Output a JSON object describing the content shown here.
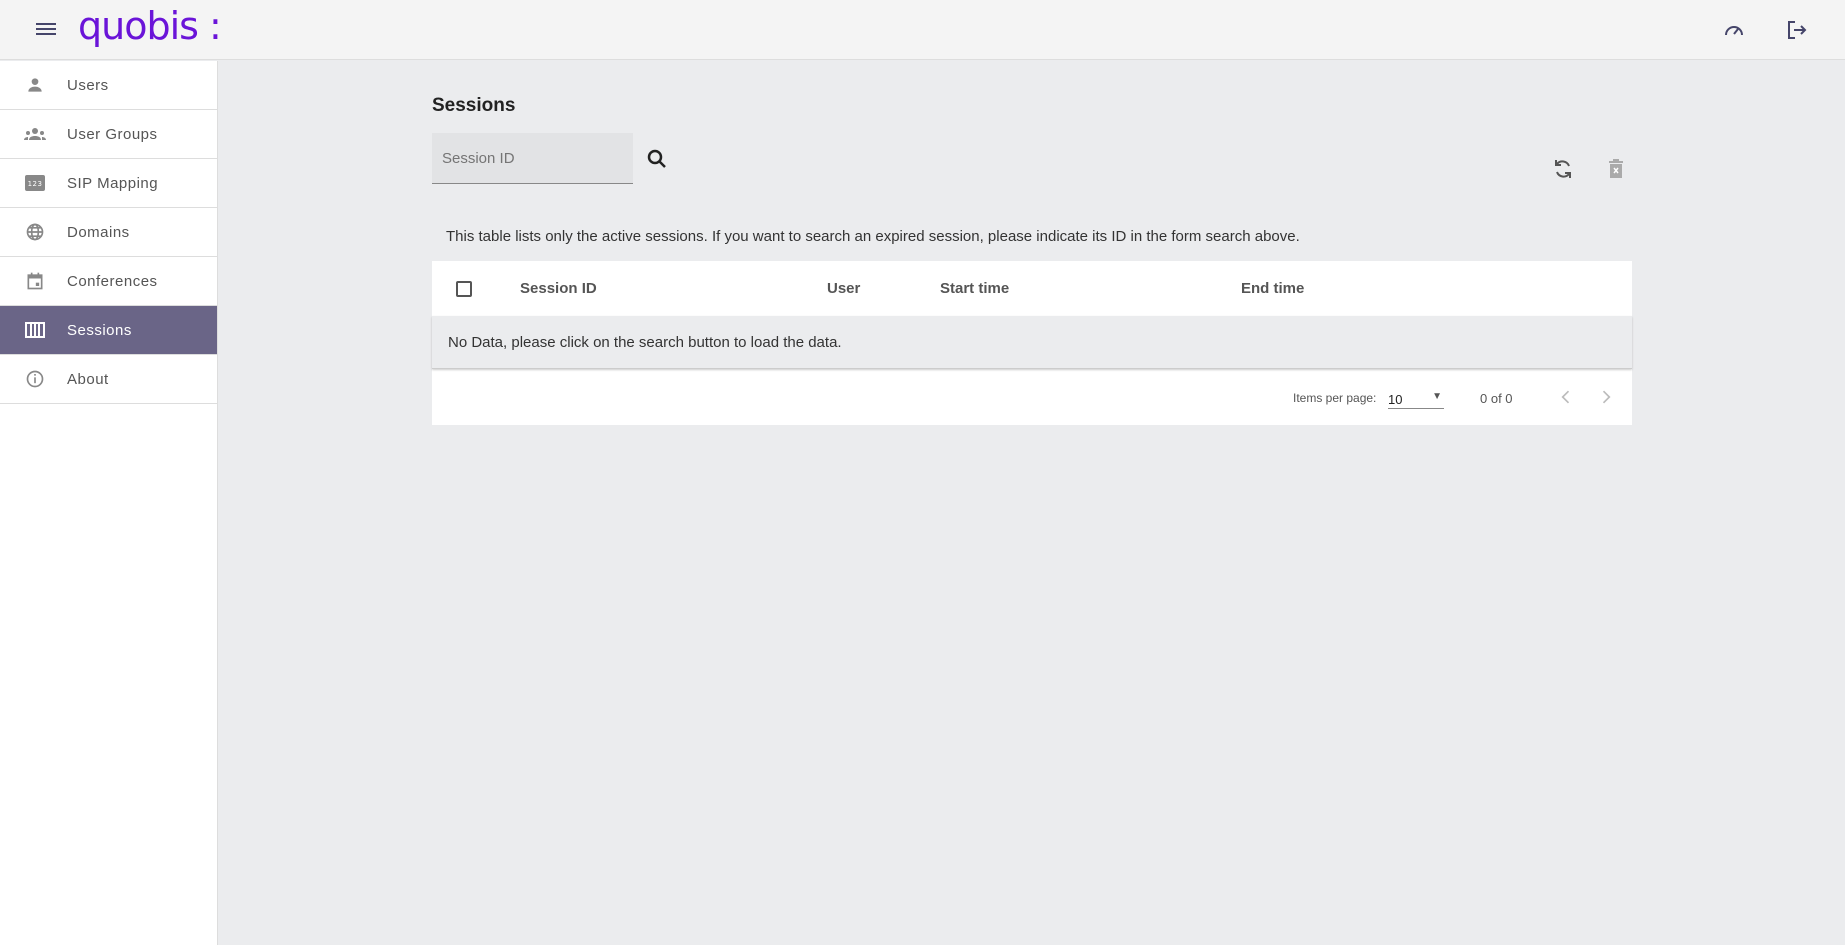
{
  "header": {
    "logo": "quobis :",
    "icons": [
      "menu-icon",
      "dashboard-icon",
      "logout-icon"
    ]
  },
  "sidebar": {
    "items": [
      {
        "label": "Users",
        "icon": "person-icon"
      },
      {
        "label": "User Groups",
        "icon": "groups-icon"
      },
      {
        "label": "SIP Mapping",
        "icon": "pin-123-icon"
      },
      {
        "label": "Domains",
        "icon": "globe-icon"
      },
      {
        "label": "Conferences",
        "icon": "calendar-icon"
      },
      {
        "label": "Sessions",
        "icon": "view-week-icon",
        "active": true
      },
      {
        "label": "About",
        "icon": "info-icon"
      }
    ]
  },
  "main": {
    "title": "Sessions",
    "search": {
      "placeholder": "Session ID",
      "value": ""
    },
    "description": "This table lists only the active sessions. If you want to search an expired session, please indicate its ID in the form search above.",
    "table": {
      "columns": [
        "Session ID",
        "User",
        "Start time",
        "End time"
      ],
      "empty": "No Data, please click on the search button to load the data."
    },
    "paginator": {
      "items_label": "Items per page:",
      "page_size": "10",
      "range": "0 of 0"
    }
  },
  "colors": {
    "brand": "#6a14d8",
    "active": "#6a6587"
  }
}
